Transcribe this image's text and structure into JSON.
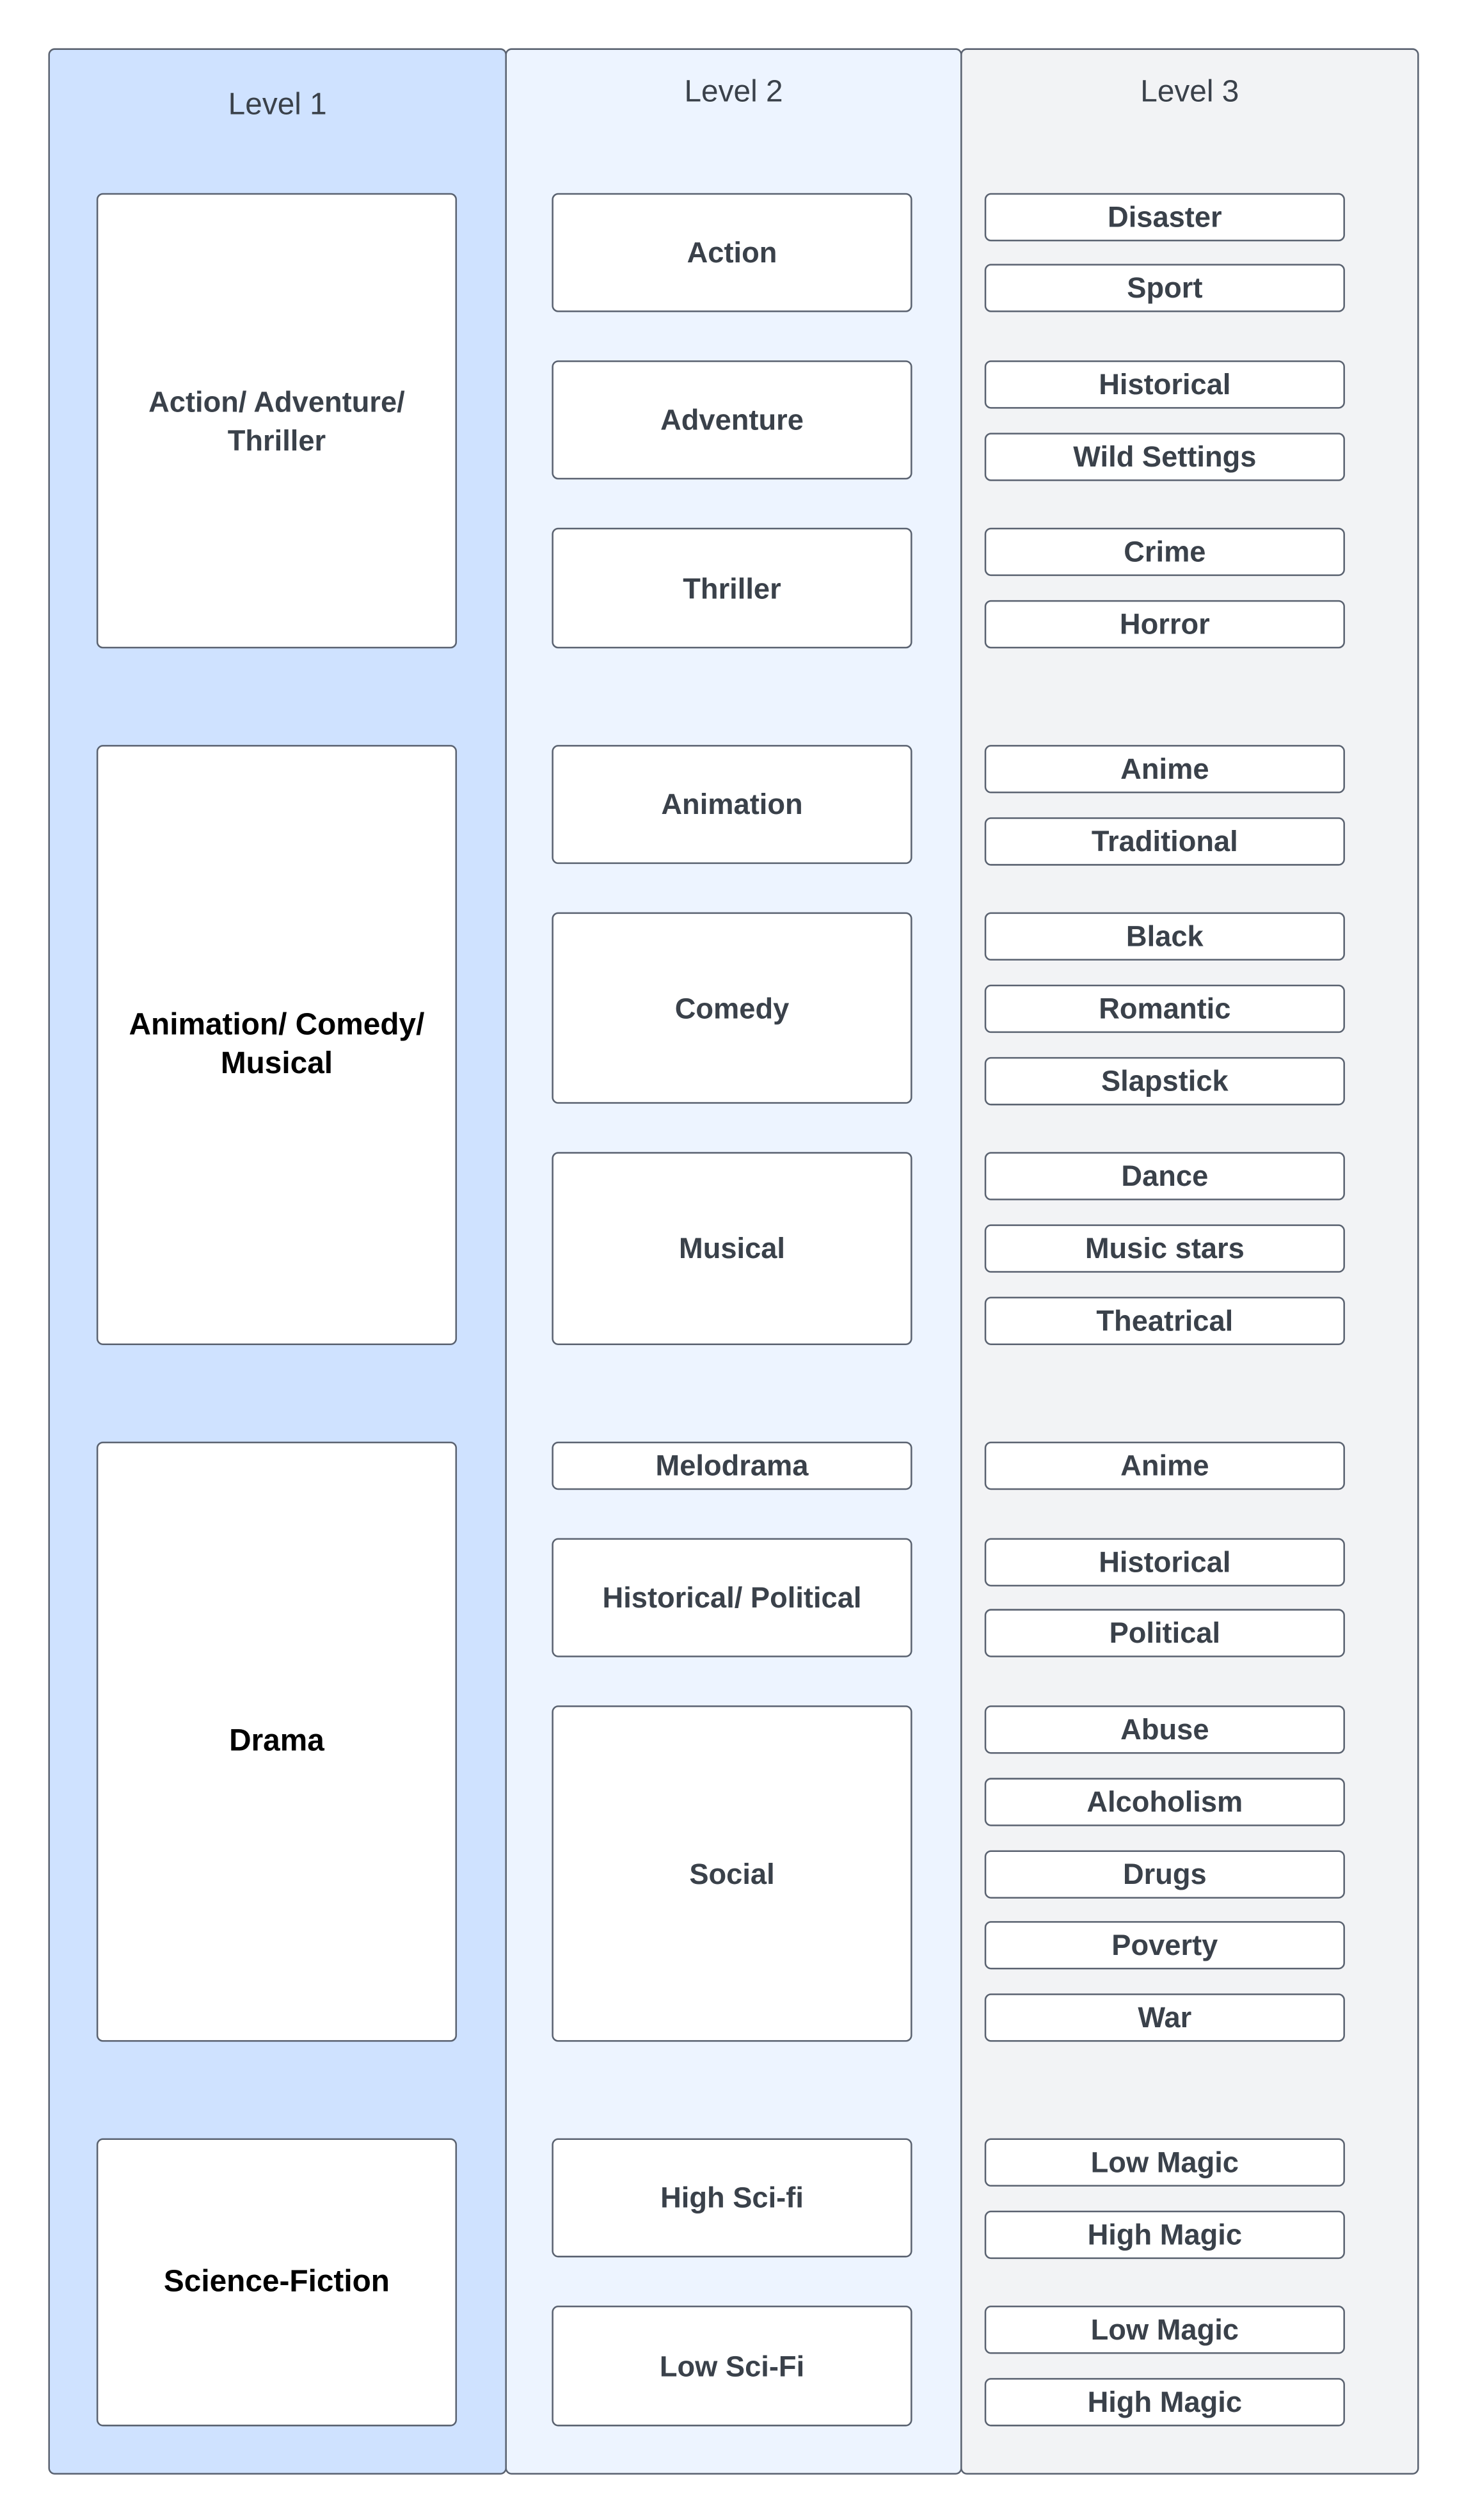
{
  "columns": [
    {
      "title": "Level 1",
      "color": "#cfe2ff"
    },
    {
      "title": "Level 2",
      "color": "#edf4ff"
    },
    {
      "title": "Level 3",
      "color": "#f2f3f5"
    }
  ],
  "level1": [
    {
      "label": "Action/ Adventure/ Thriller"
    },
    {
      "label": "Animation/ Comedy/ Musical"
    },
    {
      "label": "Drama"
    },
    {
      "label": "Science-Fiction"
    }
  ],
  "level2": [
    {
      "label": "Action"
    },
    {
      "label": "Adventure"
    },
    {
      "label": "Thriller"
    },
    {
      "label": "Animation"
    },
    {
      "label": "Comedy"
    },
    {
      "label": "Musical"
    },
    {
      "label": "Melodrama"
    },
    {
      "label": "Historical/ Political"
    },
    {
      "label": "Social"
    },
    {
      "label": "High Sci-fi"
    },
    {
      "label": "Low Sci-Fi"
    }
  ],
  "level3": [
    {
      "label": "Disaster"
    },
    {
      "label": "Sport"
    },
    {
      "label": "Historical"
    },
    {
      "label": "Wild Settings"
    },
    {
      "label": "Crime"
    },
    {
      "label": "Horror"
    },
    {
      "label": "Anime"
    },
    {
      "label": "Traditional"
    },
    {
      "label": "Black"
    },
    {
      "label": "Romantic"
    },
    {
      "label": "Slapstick"
    },
    {
      "label": "Dance"
    },
    {
      "label": "Music stars"
    },
    {
      "label": "Theatrical"
    },
    {
      "label": "Anime"
    },
    {
      "label": "Historical"
    },
    {
      "label": "Political"
    },
    {
      "label": "Abuse"
    },
    {
      "label": "Alcoholism"
    },
    {
      "label": "Drugs"
    },
    {
      "label": "Poverty"
    },
    {
      "label": "War"
    },
    {
      "label": "Low Magic"
    },
    {
      "label": "High Magic"
    },
    {
      "label": "Low Magic"
    },
    {
      "label": "High Magic"
    }
  ]
}
